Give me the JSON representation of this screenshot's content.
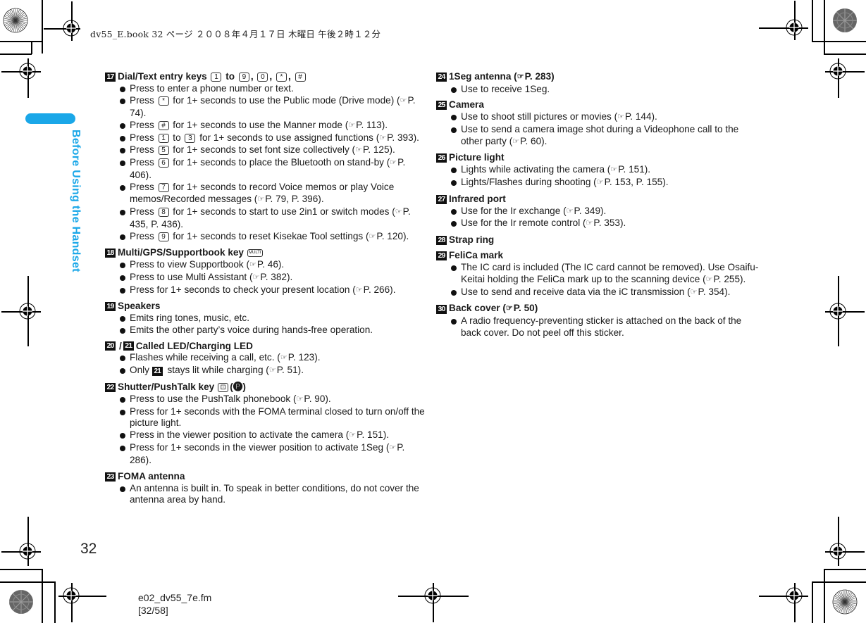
{
  "header": {
    "print_info": "dv55_E.book   32 ページ   ２００８年４月１７日   木曜日   午後２時１２分"
  },
  "side_tab": {
    "label": "Before Using the Handset",
    "color": "#1aa7e8"
  },
  "page": {
    "number": "32"
  },
  "footer": {
    "file": "e02_dv55_7e.fm",
    "pages": "[32/58]"
  },
  "ref_icon": "☞",
  "left_column": [
    {
      "num": "17",
      "title_parts": [
        "Dial/Text entry keys ",
        "1",
        " to ",
        "9",
        ", ",
        "0",
        ", ",
        "*",
        ", ",
        "#"
      ],
      "title": "Dial/Text entry keys 1 to 9, 0, *, #",
      "bullets": [
        "Press to enter a phone number or text.",
        "Press [*] for 1+ seconds to use the Public mode (Drive mode) (☞P. 74).",
        "Press [#] for 1+ seconds to use the Manner mode (☞P. 113).",
        "Press [1] to [3] for 1+ seconds to use assigned functions (☞P. 393).",
        "Press [5] for 1+ seconds to set font size collectively (☞P. 125).",
        "Press [6] for 1+ seconds to place the Bluetooth on stand-by (☞P. 406).",
        "Press [7] for 1+ seconds to record Voice memos or play Voice memos/Recorded messages (☞P. 79, P. 396).",
        "Press [8] for 1+ seconds to start to use 2in1 or switch modes (☞P. 435, P. 436).",
        "Press [9] for 1+ seconds to reset Kisekae Tool settings (☞P. 120)."
      ]
    },
    {
      "num": "18",
      "title": "Multi/GPS/Supportbook key",
      "key": "MULTI",
      "bullets": [
        "Press to view Supportbook (☞P. 46).",
        "Press to use Multi Assistant (☞P. 382).",
        "Press for 1+ seconds to check your present location (☞P. 266)."
      ]
    },
    {
      "num": "19",
      "title": "Speakers",
      "bullets": [
        "Emits ring tones, music, etc.",
        "Emits the other party’s voice during hands-free operation."
      ]
    },
    {
      "num": "20",
      "num2": "21",
      "title": "Called LED/Charging LED",
      "bullets": [
        "Flashes while receiving a call, etc. (☞P. 123).",
        "Only [21] stays lit while charging (☞P. 51)."
      ]
    },
    {
      "num": "22",
      "title": "Shutter/PushTalk key",
      "key": "⊡",
      "key_alt": "(🅟)",
      "bullets": [
        "Press to use the PushTalk phonebook (☞P. 90).",
        "Press for 1+ seconds with the FOMA terminal closed to turn on/off the picture light.",
        "Press in the viewer position to activate the camera (☞P. 151).",
        "Press for 1+ seconds in the viewer position to activate 1Seg (☞P. 286)."
      ]
    },
    {
      "num": "23",
      "title": "FOMA antenna",
      "bullets": [
        "An antenna is built in. To speak in better conditions, do not cover the antenna area by hand."
      ]
    }
  ],
  "right_column": [
    {
      "num": "24",
      "title": "1Seg antenna (☞P. 283)",
      "bullets": [
        "Use to receive 1Seg."
      ]
    },
    {
      "num": "25",
      "title": "Camera",
      "bullets": [
        "Use to shoot still pictures or movies (☞P. 144).",
        "Use to send a camera image shot during a Videophone call to the other party (☞P. 60)."
      ]
    },
    {
      "num": "26",
      "title": "Picture light",
      "bullets": [
        "Lights while activating the camera (☞P. 151).",
        "Lights/Flashes during shooting (☞P. 153, P. 155)."
      ]
    },
    {
      "num": "27",
      "title": "Infrared port",
      "bullets": [
        "Use for the Ir exchange (☞P. 349).",
        "Use for the Ir remote control (☞P. 353)."
      ]
    },
    {
      "num": "28",
      "title": "Strap ring",
      "bullets": []
    },
    {
      "num": "29",
      "title": "FeliCa mark",
      "bullets": [
        "The IC card is included (The IC card cannot be removed). Use Osaifu-Keitai holding the FeliCa mark up to the scanning device (☞P. 255).",
        "Use to send and receive data via the iC transmission (☞P. 354)."
      ]
    },
    {
      "num": "30",
      "title": "Back cover (☞P. 50)",
      "bullets": [
        "A radio frequency-preventing sticker is attached on the back of the back cover. Do not peel off this sticker."
      ]
    }
  ]
}
